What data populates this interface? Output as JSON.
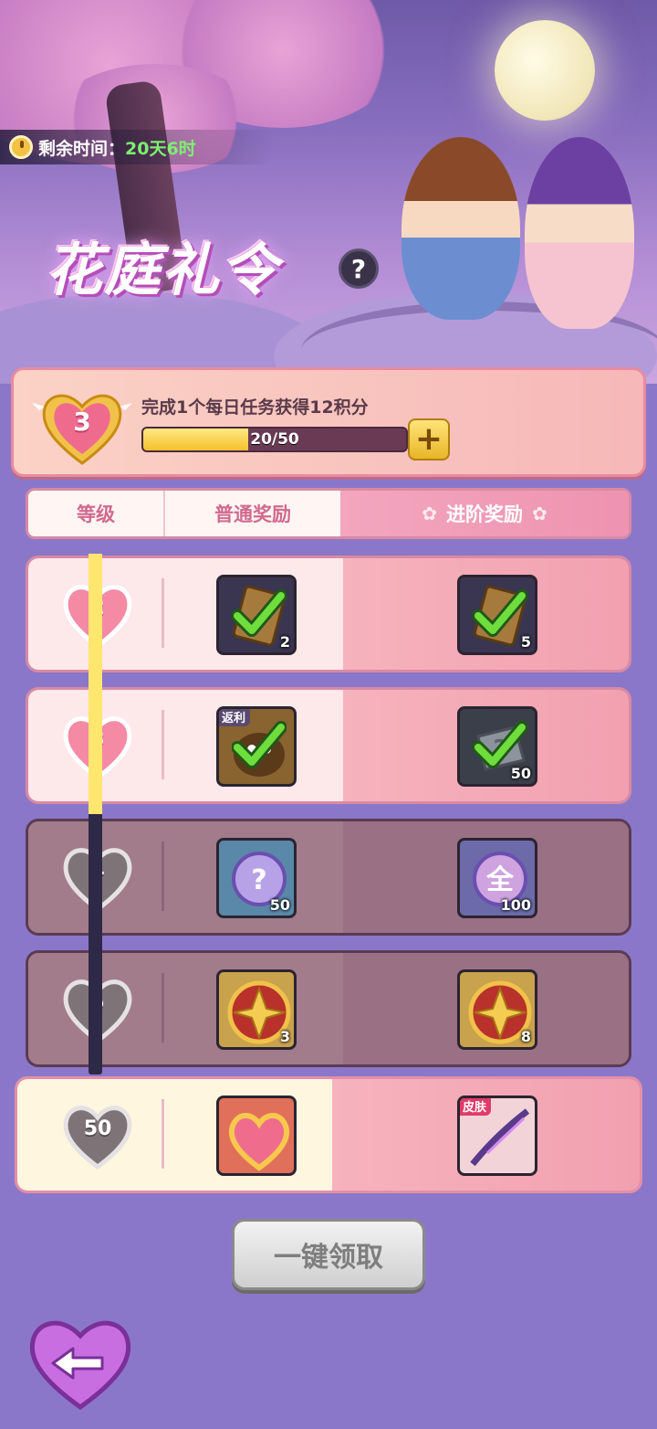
{
  "header": {
    "timer_label": "剩余时间：",
    "timer_value": "20天6时",
    "title": "花庭礼令",
    "help_label": "?"
  },
  "progress": {
    "current_level": "3",
    "task_text": "完成1个每日任务获得12积分",
    "progress_text": "20/50",
    "progress_fraction": 0.4,
    "add_button_label": "+"
  },
  "tabs": {
    "level": "等级",
    "normal": "普通奖励",
    "advanced": "进阶奖励"
  },
  "track_fill_fraction": 0.5,
  "rows": [
    {
      "level": "2",
      "state": "claimed",
      "normal": {
        "icon": "scroll-ticket-icon",
        "count": "2",
        "claimed": true,
        "badge": ""
      },
      "advanced": {
        "icon": "scroll-ticket-icon",
        "count": "5",
        "claimed": true,
        "badge": ""
      }
    },
    {
      "level": "3",
      "state": "claimed",
      "normal": {
        "icon": "creature-pet-icon",
        "count": "",
        "claimed": true,
        "badge": "返利"
      },
      "advanced": {
        "icon": "mystery-shard-icon",
        "count": "50",
        "claimed": true,
        "badge": ""
      }
    },
    {
      "level": "4",
      "state": "locked",
      "normal": {
        "icon": "question-orb-icon",
        "count": "50",
        "claimed": false,
        "badge": ""
      },
      "advanced": {
        "icon": "all-orb-icon",
        "count": "100",
        "claimed": false,
        "badge": "",
        "orb_text": "全"
      }
    },
    {
      "level": "5",
      "state": "locked",
      "normal": {
        "icon": "golden-flower-medal-icon",
        "count": "3",
        "claimed": false,
        "badge": ""
      },
      "advanced": {
        "icon": "golden-flower-medal-icon",
        "count": "8",
        "claimed": false,
        "badge": ""
      }
    },
    {
      "level": "50",
      "state": "final",
      "normal": {
        "icon": "heart-jewel-icon",
        "count": "",
        "claimed": false,
        "badge": ""
      },
      "advanced": {
        "icon": "skin-bow-icon",
        "count": "",
        "claimed": false,
        "badge": "皮肤"
      }
    }
  ],
  "claim_all_label": "一键领取",
  "colors": {
    "accent_pink": "#ee93b1",
    "progress_yellow": "#f4c12c",
    "timer_green": "#7df070",
    "locked_row": "#9a7084"
  }
}
